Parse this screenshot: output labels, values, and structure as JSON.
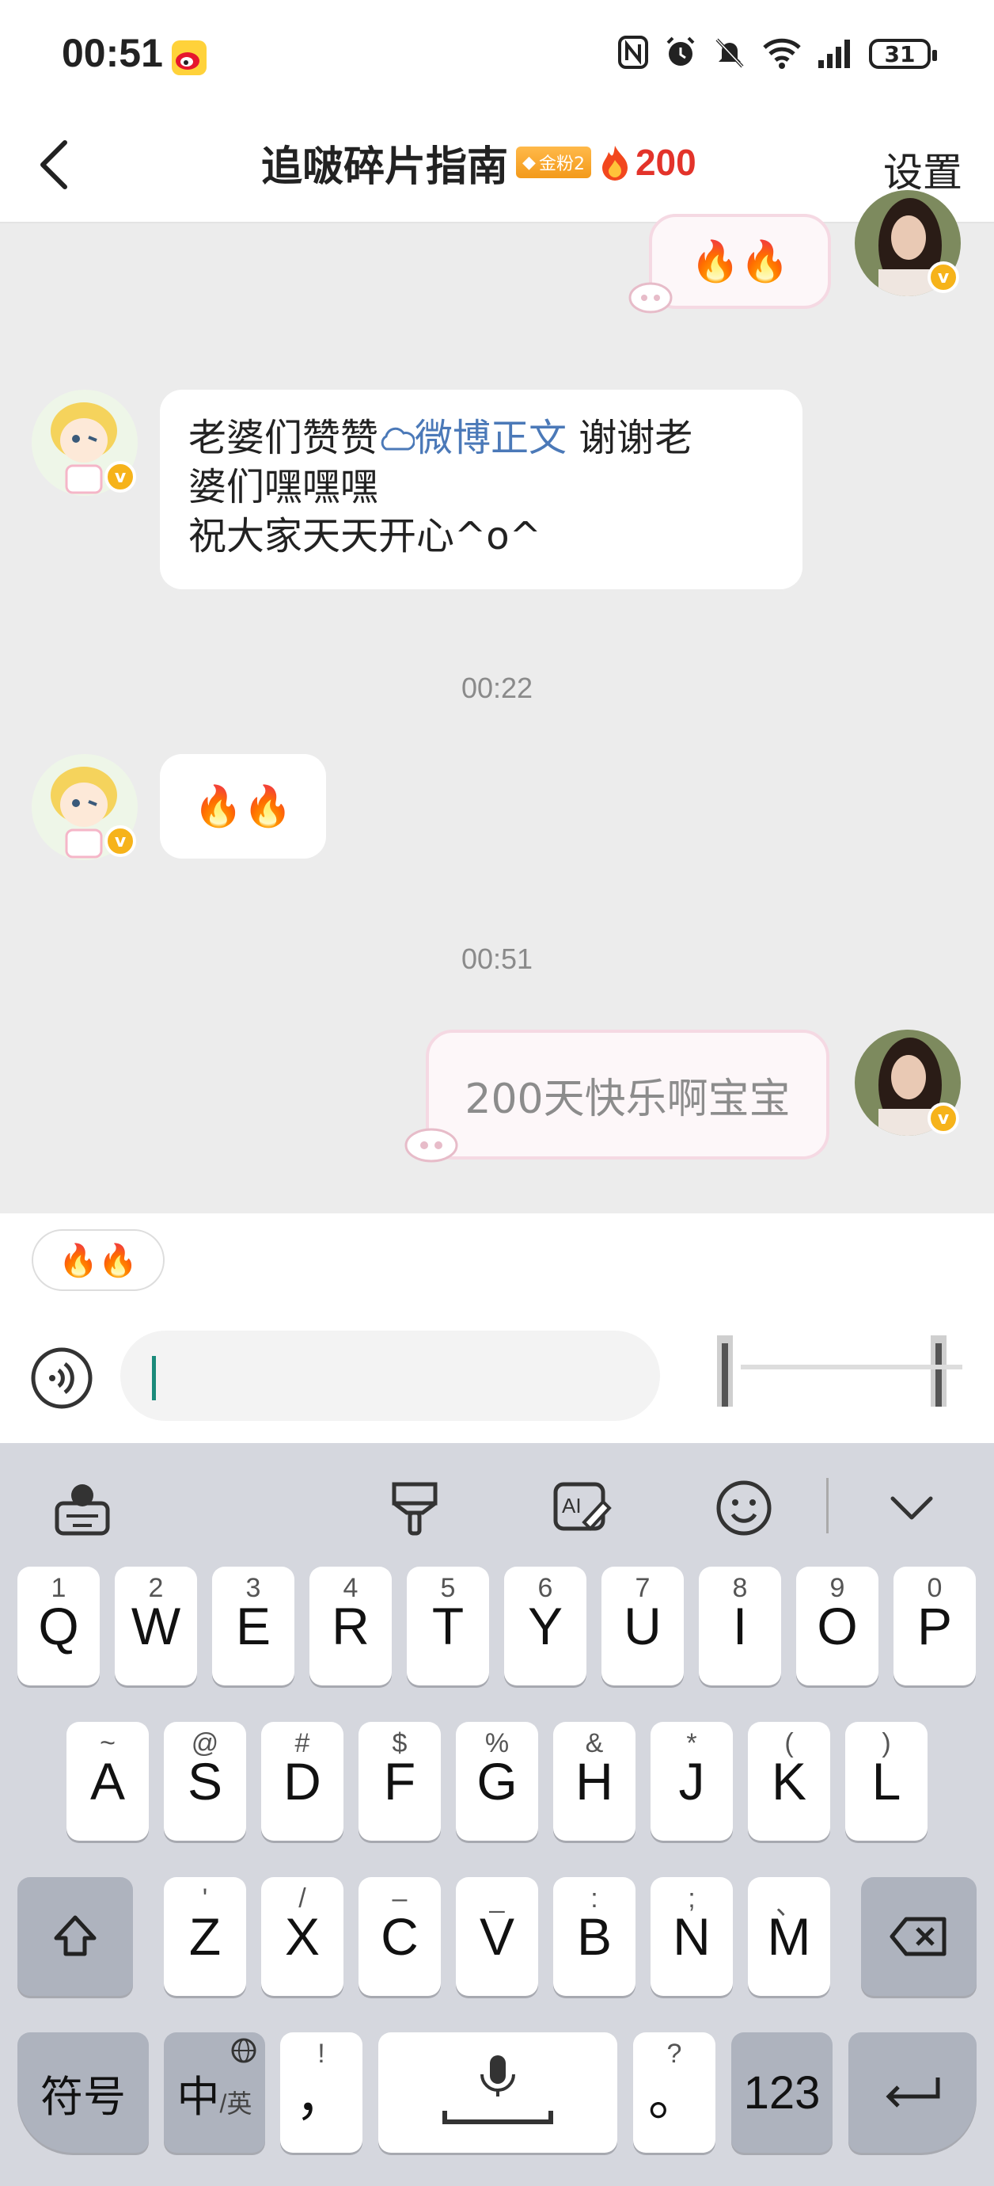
{
  "status_bar": {
    "time": "00:51",
    "battery": "31"
  },
  "header": {
    "title": "追啵碎片指南",
    "fan_badge": "金粉2",
    "fire_count": "200",
    "settings_label": "设置"
  },
  "messages": {
    "m1_right": "🔥🔥",
    "m2_left_prefix": "老婆们赞赞",
    "m2_link": "微博正文",
    "m2_suffix_line1": " 谢谢老",
    "m2_line2": "婆们嘿嘿嘿",
    "m2_line3": "祝大家天天开心^o^",
    "ts1": "00:22",
    "m3_left": "🔥🔥",
    "ts2": "00:51",
    "m4_right": "200天快乐啊宝宝"
  },
  "input": {
    "quick_reply": "🔥🔥",
    "placeholder": ""
  },
  "keyboard": {
    "row1": [
      {
        "main": "Q",
        "sub": "1"
      },
      {
        "main": "W",
        "sub": "2"
      },
      {
        "main": "E",
        "sub": "3"
      },
      {
        "main": "R",
        "sub": "4"
      },
      {
        "main": "T",
        "sub": "5"
      },
      {
        "main": "Y",
        "sub": "6"
      },
      {
        "main": "U",
        "sub": "7"
      },
      {
        "main": "I",
        "sub": "8"
      },
      {
        "main": "O",
        "sub": "9"
      },
      {
        "main": "P",
        "sub": "0"
      }
    ],
    "row2": [
      {
        "main": "A",
        "sub": "~"
      },
      {
        "main": "S",
        "sub": "@"
      },
      {
        "main": "D",
        "sub": "#"
      },
      {
        "main": "F",
        "sub": "$"
      },
      {
        "main": "G",
        "sub": "%"
      },
      {
        "main": "H",
        "sub": "&"
      },
      {
        "main": "J",
        "sub": "*"
      },
      {
        "main": "K",
        "sub": "("
      },
      {
        "main": "L",
        "sub": ")"
      }
    ],
    "row3": [
      {
        "main": "Z",
        "sub": "'"
      },
      {
        "main": "X",
        "sub": "/"
      },
      {
        "main": "C",
        "sub": "–"
      },
      {
        "main": "V",
        "sub": "_"
      },
      {
        "main": "B",
        "sub": ":"
      },
      {
        "main": "N",
        "sub": ";"
      },
      {
        "main": "M",
        "sub": "、"
      }
    ],
    "symbols_label": "符号",
    "lang_label_main": "中",
    "lang_label_sub": "/英",
    "comma_main": "，",
    "comma_sub": "!",
    "period_main": "。",
    "period_sub": "?",
    "num_label": "123"
  }
}
